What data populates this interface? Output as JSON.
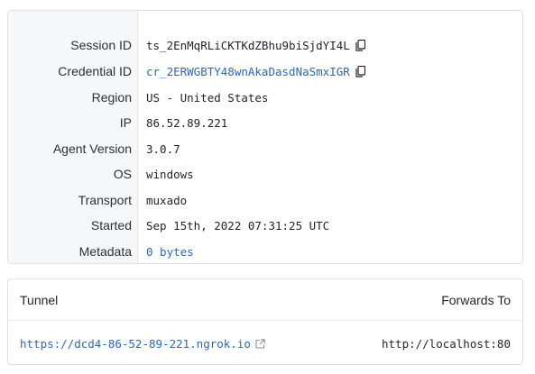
{
  "details": {
    "rows": [
      {
        "key": "Session ID",
        "value": "ts_2EnMqRLiCKTKdZBhu9biSjdYI4L",
        "link": false,
        "copy": true
      },
      {
        "key": "Credential ID",
        "value": "cr_2ERWGBTY48wnAkaDasdNaSmxIGR",
        "link": true,
        "copy": true
      },
      {
        "key": "Region",
        "value": "US - United States",
        "link": false,
        "copy": false
      },
      {
        "key": "IP",
        "value": "86.52.89.221",
        "link": false,
        "copy": false
      },
      {
        "key": "Agent Version",
        "value": "3.0.7",
        "link": false,
        "copy": false
      },
      {
        "key": "OS",
        "value": "windows",
        "link": false,
        "copy": false
      },
      {
        "key": "Transport",
        "value": "muxado",
        "link": false,
        "copy": false
      },
      {
        "key": "Started",
        "value": "Sep 15th, 2022 07:31:25 UTC",
        "link": false,
        "copy": false
      },
      {
        "key": "Metadata",
        "value": "0 bytes",
        "link": true,
        "copy": false
      }
    ]
  },
  "tunnel": {
    "header_tunnel": "Tunnel",
    "header_forwards": "Forwards To",
    "url": "https://dcd4-86-52-89-221.ngrok.io",
    "forwards_to": "http://localhost:80"
  },
  "colors": {
    "link": "#2a66c9",
    "label_bg": "#f6f7f9",
    "border": "#dcdfe4"
  },
  "icons": {
    "copy": "copy-icon",
    "external": "external-link-icon"
  }
}
